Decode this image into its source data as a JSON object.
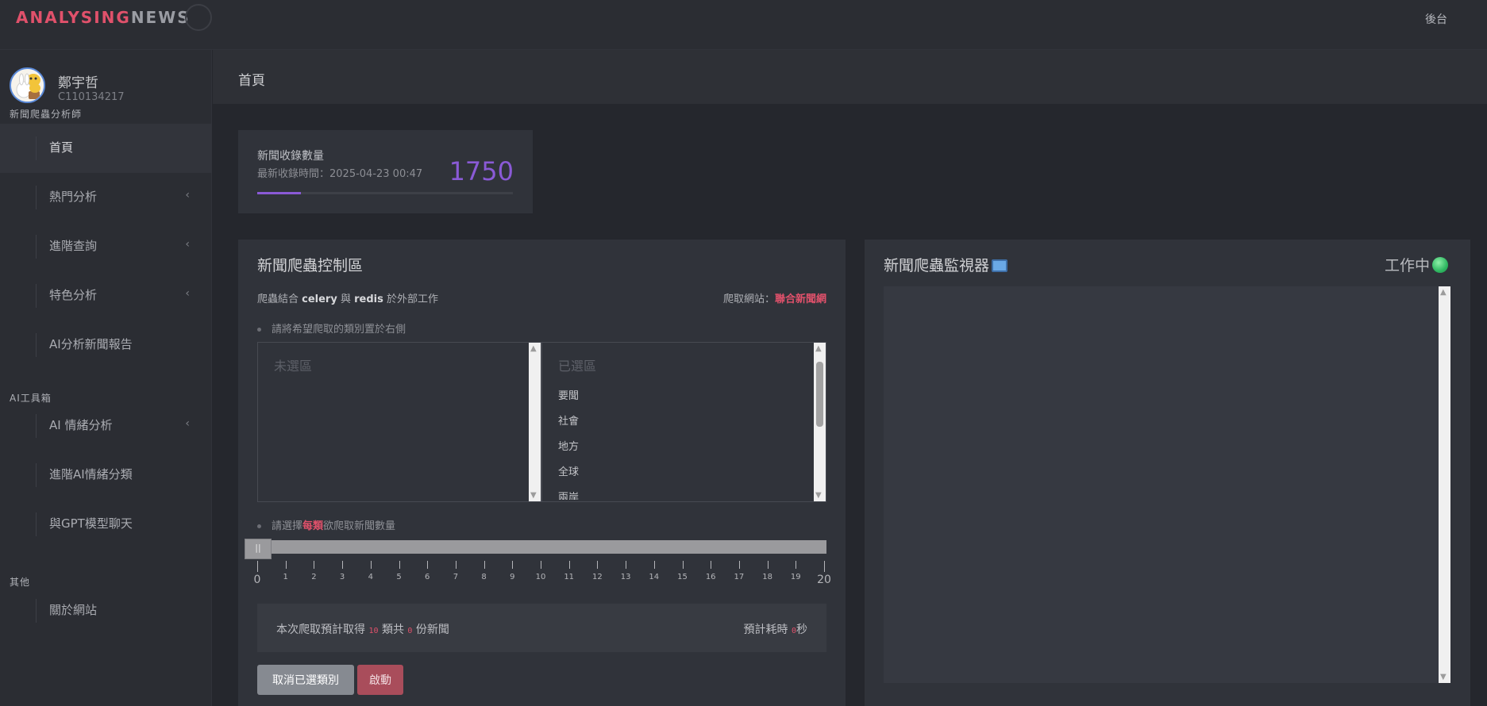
{
  "header": {
    "logo_part1": "ANALYSING",
    "logo_part2": "NEWS",
    "admin_link": "後台"
  },
  "user": {
    "name": "鄭宇哲",
    "id": "C110134217"
  },
  "sidebar": {
    "section1": "新聞爬蟲分析師",
    "items1": [
      "首頁",
      "熱門分析",
      "進階查詢",
      "特色分析",
      "AI分析新聞報告"
    ],
    "section2": "AI工具箱",
    "items2": [
      "AI 情緒分析",
      "進階AI情緒分類",
      "與GPT模型聊天"
    ],
    "section3": "其他",
    "items3": [
      "關於網站"
    ],
    "active": "首頁"
  },
  "page": {
    "title": "首頁"
  },
  "stat": {
    "title": "新聞收錄數量",
    "subtitle": "最新收錄時間：2025-04-23 00:47",
    "count": "1750",
    "progress": 0.17,
    "accent": "#8a5ad6"
  },
  "control": {
    "title": "新聞爬蟲控制區",
    "desc_pre": "爬蟲結合 ",
    "desc_celery": "celery",
    "desc_mid": " 與 ",
    "desc_redis": "redis",
    "desc_post": " 於外部工作",
    "site_label": "爬取網站：",
    "site_name": "聯合新聞網",
    "hint1": "請將希望爬取的類別置於右側",
    "unselected_placeholder": "未選區",
    "selected_placeholder": "已選區",
    "selected_items": [
      "要聞",
      "社會",
      "地方",
      "全球",
      "兩岸"
    ],
    "hint2_pre": "請選擇",
    "hint2_hl": "每類",
    "hint2_post": "欲爬取新聞數量",
    "slider": {
      "min": 0,
      "max": 20,
      "value": 0,
      "handle_glyph": "||",
      "tick_labels": [
        "0",
        "1",
        "2",
        "3",
        "4",
        "5",
        "6",
        "7",
        "8",
        "9",
        "10",
        "11",
        "12",
        "13",
        "14",
        "15",
        "16",
        "17",
        "18",
        "19",
        "20"
      ]
    },
    "summary_pre": "本次爬取預計取得 ",
    "summary_categories": "10",
    "summary_mid": " 類共 ",
    "summary_total": "0",
    "summary_post": " 份新聞",
    "time_pre": "預計耗時 ",
    "time_value": "0",
    "time_post": "秒",
    "cancel_label": "取消已選類別",
    "start_label": "啟動"
  },
  "monitor": {
    "title": "新聞爬蟲監視器",
    "status": "工作中",
    "icon": "computer-icon",
    "status_icon": "green-dot-icon"
  }
}
